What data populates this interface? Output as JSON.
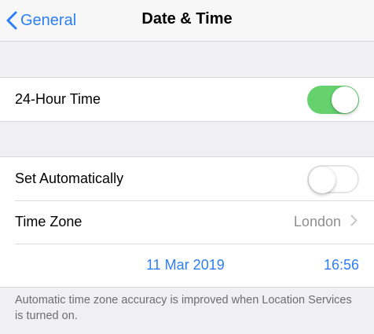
{
  "navbar": {
    "back_label": "General",
    "title": "Date & Time"
  },
  "settings": {
    "hour24": {
      "label": "24-Hour Time",
      "enabled": true
    },
    "set_automatically": {
      "label": "Set Automatically",
      "enabled": false
    },
    "time_zone": {
      "label": "Time Zone",
      "value": "London"
    },
    "date": "11 Mar 2019",
    "time": "16:56"
  },
  "footer": {
    "note": "Automatic time zone accuracy is improved when Location Services is turned on."
  },
  "colors": {
    "accent": "#2d7ef7",
    "switch_on": "#65d26e",
    "background": "#efeff4"
  }
}
